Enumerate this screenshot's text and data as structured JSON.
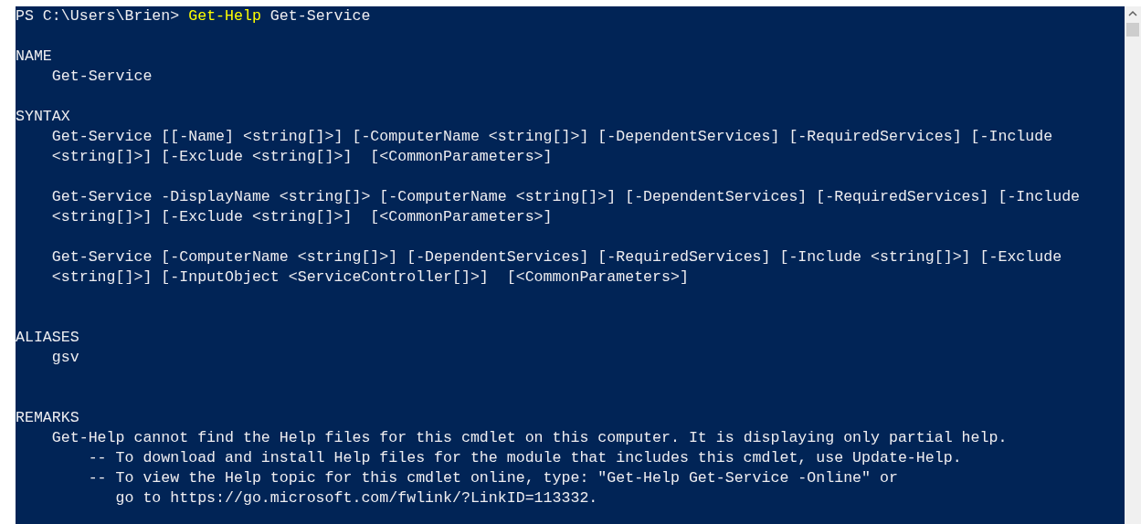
{
  "prompt": {
    "path": "PS C:\\Users\\Brien>",
    "command": "Get-Help",
    "argument": "Get-Service"
  },
  "lines": [
    {
      "kind": "blank"
    },
    {
      "kind": "heading",
      "text": "NAME"
    },
    {
      "kind": "text",
      "text": "Get-Service"
    },
    {
      "kind": "blank"
    },
    {
      "kind": "heading",
      "text": "SYNTAX"
    },
    {
      "kind": "text",
      "text": "Get-Service [[-Name] <string[]>] [-ComputerName <string[]>] [-DependentServices] [-RequiredServices] [-Include"
    },
    {
      "kind": "text",
      "text": "<string[]>] [-Exclude <string[]>]  [<CommonParameters>]"
    },
    {
      "kind": "blank"
    },
    {
      "kind": "text",
      "text": "Get-Service -DisplayName <string[]> [-ComputerName <string[]>] [-DependentServices] [-RequiredServices] [-Include"
    },
    {
      "kind": "text",
      "text": "<string[]>] [-Exclude <string[]>]  [<CommonParameters>]"
    },
    {
      "kind": "blank"
    },
    {
      "kind": "text",
      "text": "Get-Service [-ComputerName <string[]>] [-DependentServices] [-RequiredServices] [-Include <string[]>] [-Exclude"
    },
    {
      "kind": "text",
      "text": "<string[]>] [-InputObject <ServiceController[]>]  [<CommonParameters>]"
    },
    {
      "kind": "blank"
    },
    {
      "kind": "blank"
    },
    {
      "kind": "heading",
      "text": "ALIASES"
    },
    {
      "kind": "text",
      "text": "gsv"
    },
    {
      "kind": "blank"
    },
    {
      "kind": "blank"
    },
    {
      "kind": "heading",
      "text": "REMARKS"
    },
    {
      "kind": "text",
      "text": "Get-Help cannot find the Help files for this cmdlet on this computer. It is displaying only partial help."
    },
    {
      "kind": "bullet",
      "text": "-- To download and install Help files for the module that includes this cmdlet, use Update-Help."
    },
    {
      "kind": "bullet",
      "text": "-- To view the Help topic for this cmdlet online, type: \"Get-Help Get-Service -Online\" or"
    },
    {
      "kind": "continuation",
      "text": "go to https://go.microsoft.com/fwlink/?LinkID=113332."
    }
  ]
}
